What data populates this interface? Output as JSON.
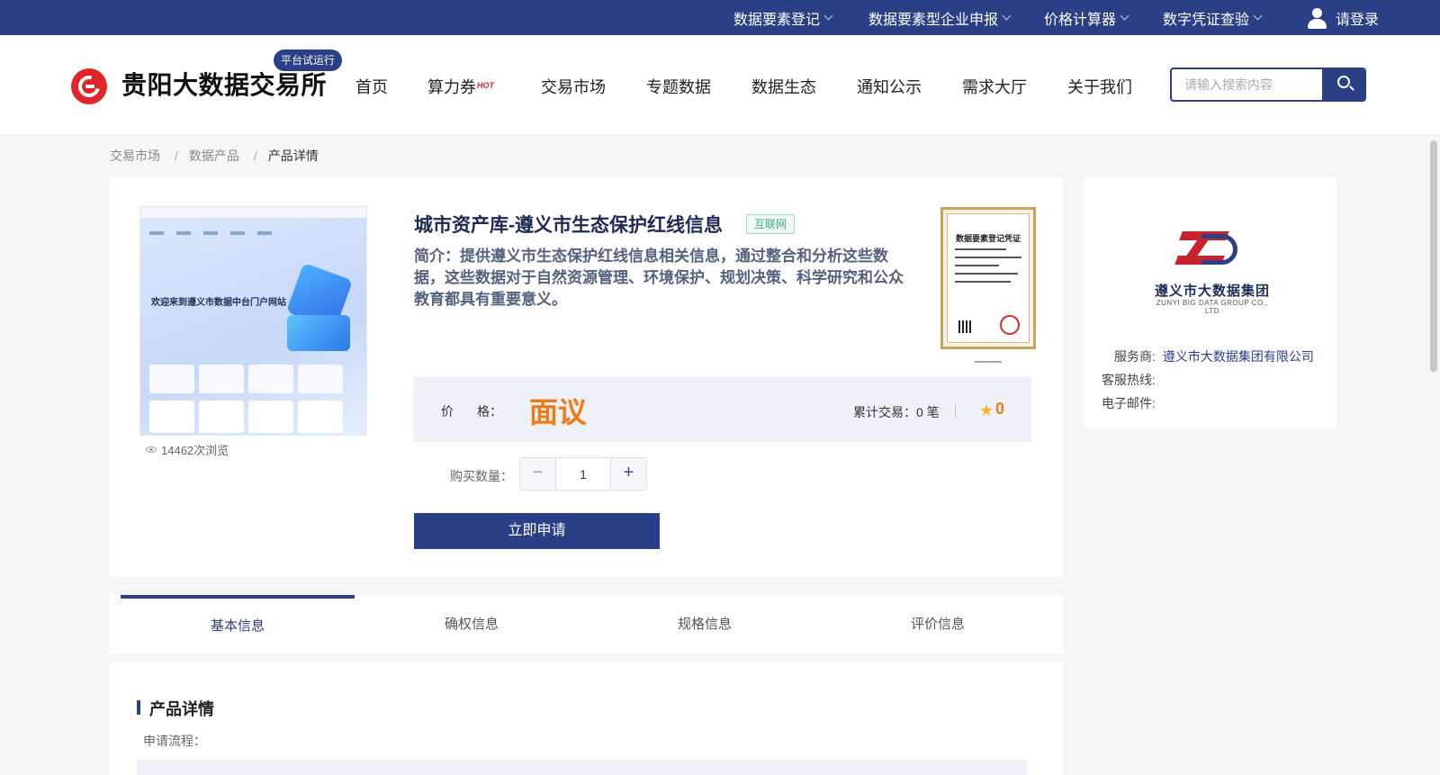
{
  "topbar": {
    "menus": [
      "数据要素登记",
      "数据要素型企业申报",
      "价格计算器",
      "数字凭证查验"
    ],
    "login_label": "请登录"
  },
  "header": {
    "logo_text": "贵阳大数据交易所",
    "trial_badge": "平台试运行",
    "nav": [
      "首页",
      "算力券",
      "交易市场",
      "专题数据",
      "数据生态",
      "通知公示",
      "需求大厅",
      "关于我们"
    ],
    "hot_badge": "HOT",
    "search_placeholder": "请输入搜索内容"
  },
  "breadcrumb": [
    "交易市场",
    "数据产品",
    "产品详情"
  ],
  "product": {
    "title": "城市资产库-遵义市生态保护红线信息",
    "tag": "互联网",
    "description": "简介：提供遵义市生态保护红线信息相关信息，通过整合和分析这些数据，这些数据对于自然资源管理、环境保护、规划决策、科学研究和公众教育都具有重要意义。",
    "views": "14462次浏览",
    "image_caption": "欢迎来到遵义市数据中台门户网站",
    "certificate_title": "数据要素登记凭证",
    "price_label_1": "价",
    "price_label_2": "格：",
    "price_value": "面议",
    "trade_count": "累计交易：0 笔",
    "rating": "0",
    "quantity_label": "购买数量：",
    "quantity": "1",
    "apply_label": "立即申请"
  },
  "provider": {
    "logo_cn": "遵义市大数据集团",
    "logo_en": "ZUNYI BIG DATA GROUP CO., LTD",
    "provider_label": "服务商:",
    "provider_name": "遵义市大数据集团有限公司",
    "hotline_label": "客服热线:",
    "email_label": "电子邮件:"
  },
  "tabs": [
    "基本信息",
    "确权信息",
    "规格信息",
    "评价信息"
  ],
  "details": {
    "title": "产品详情",
    "subtitle": "申请流程："
  },
  "colors": {
    "primary": "#2b3f86",
    "accent_orange": "#f07a16",
    "brand_red": "#e0262b"
  }
}
